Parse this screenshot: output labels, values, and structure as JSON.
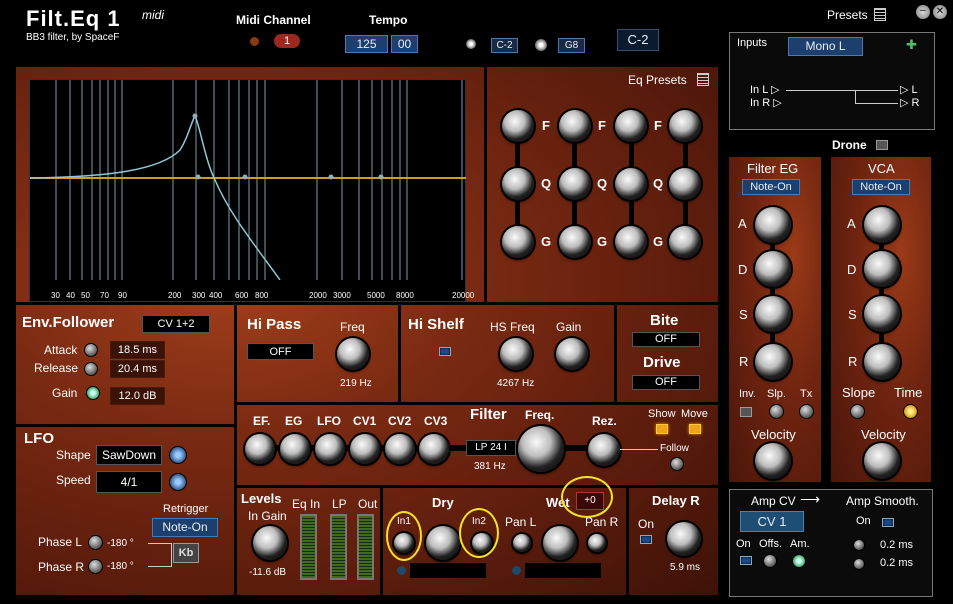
{
  "header": {
    "title": "Filt.Eq 1",
    "midi_tag": "midi",
    "subtitle": "BB3 filter, by SpaceF",
    "midi_channel_label": "Midi Channel",
    "midi_channel_value": "1",
    "tempo_label": "Tempo",
    "tempo_a": "125",
    "tempo_b": "00",
    "key_low": "C-2",
    "key_high": "G8",
    "note_display": "C-2",
    "presets_label": "Presets"
  },
  "io": {
    "inputs_label": "Inputs",
    "mode": "Mono L",
    "in_l": "In L ▷",
    "in_r": "In R ▷",
    "out_l": "▷ L",
    "out_r": "▷ R"
  },
  "eq": {
    "presets_label": "Eq Presets",
    "freq_ticks": [
      "30",
      "40",
      "50",
      "70",
      "90",
      "200",
      "300",
      "400",
      "600",
      "800",
      "2000",
      "3000",
      "5000",
      "8000",
      "20000"
    ],
    "band_labels": [
      "F",
      "F",
      "F",
      "Q",
      "Q",
      "Q",
      "G",
      "G",
      "G"
    ]
  },
  "env": {
    "title": "Env.Follower",
    "mode": "CV 1+2",
    "attack_label": "Attack",
    "attack": "18.5 ms",
    "release_label": "Release",
    "release": "20.4 ms",
    "gain_label": "Gain",
    "gain": "12.0 dB"
  },
  "hipass": {
    "title": "Hi Pass",
    "state": "OFF",
    "freq_label": "Freq",
    "freq": "219 Hz"
  },
  "hishelf": {
    "title": "Hi Shelf",
    "hs_freq_label": "HS Freq",
    "gain_label": "Gain",
    "hs_freq": "4267 Hz"
  },
  "bite": {
    "bite_label": "Bite",
    "bite_state": "OFF",
    "drive_label": "Drive",
    "drive_state": "OFF"
  },
  "drone": {
    "label": "Drone"
  },
  "filtereg": {
    "title": "Filter EG",
    "mode": "Note-On",
    "a": "A",
    "d": "D",
    "s": "S",
    "r": "R",
    "inv": "Inv.",
    "slp": "Slp.",
    "tx": "Tx",
    "velocity": "Velocity"
  },
  "vca": {
    "title": "VCA",
    "mode": "Note-On",
    "a": "A",
    "d": "D",
    "s": "S",
    "r": "R",
    "slope": "Slope",
    "time": "Time",
    "velocity": "Velocity"
  },
  "lfo": {
    "title": "LFO",
    "shape_label": "Shape",
    "shape": "SawDown",
    "speed_label": "Speed",
    "speed": "4/1",
    "retrigger_label": "Retrigger",
    "retrigger": "Note-On",
    "phase_l_label": "Phase L",
    "phase_l": "-180 °",
    "phase_r_label": "Phase R",
    "phase_r": "-180 °",
    "kb": "Kb"
  },
  "filter": {
    "mods": [
      "EF.",
      "EG",
      "LFO",
      "CV1",
      "CV2",
      "CV3"
    ],
    "title": "Filter",
    "freq_label": "Freq.",
    "type": "LP 24 I",
    "freq": "381 Hz",
    "rez_label": "Rez.",
    "show": "Show",
    "move": "Move",
    "follow": "Follow"
  },
  "levels": {
    "title": "Levels",
    "in_gain_label": "In Gain",
    "in_gain": "-11.6 dB",
    "eq_in": "Eq In",
    "lp": "LP",
    "out": "Out"
  },
  "mix": {
    "dry": "Dry",
    "wet": "Wet",
    "wet_value": "+0",
    "in1": "In1",
    "in2": "In2",
    "pan_l": "Pan L",
    "pan_r": "Pan R"
  },
  "delay": {
    "title": "Delay R",
    "on": "On",
    "time": "5.9 ms"
  },
  "ampcv": {
    "title": "Amp CV",
    "arrow": "⟶",
    "smooth": "Amp Smooth.",
    "source": "CV 1",
    "on": "On",
    "on2": "On",
    "offs": "Offs.",
    "am": "Am.",
    "t1": "0.2 ms",
    "t2": "0.2 ms"
  },
  "colors": {
    "rust": "#7a2a12",
    "blue_display": "#1d3f6e",
    "eq_grid": "#7d97a7",
    "eq_curve": "#8ec7d6",
    "eq_flat": "#d49a2a",
    "highlight": "#f4e22a"
  }
}
